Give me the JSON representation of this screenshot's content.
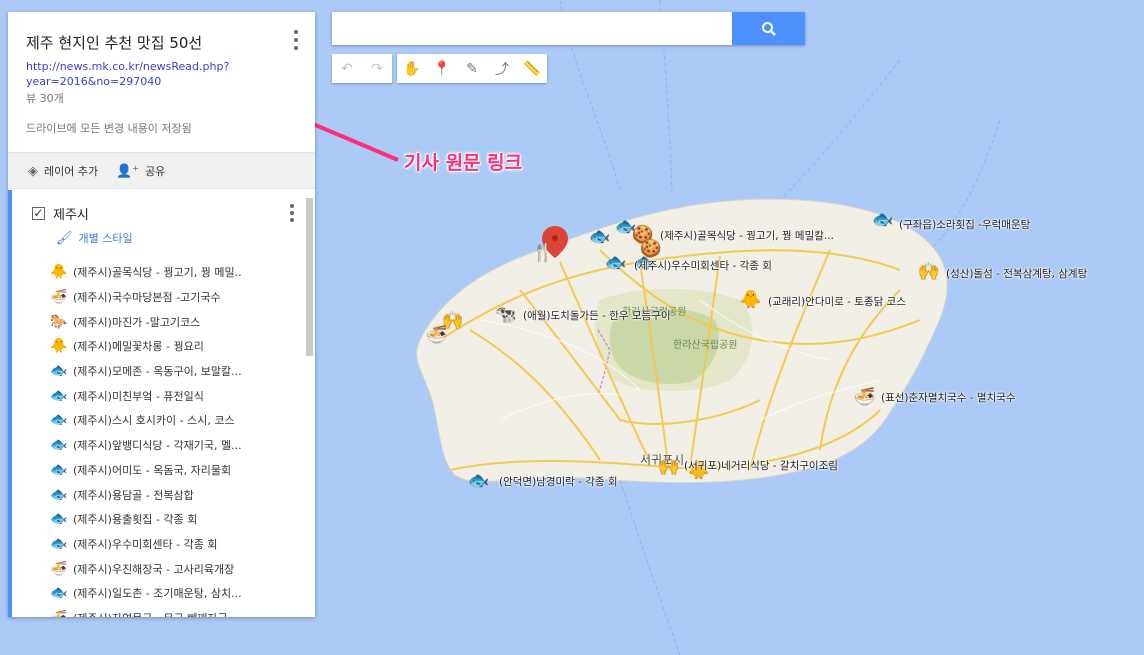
{
  "panel": {
    "title": "제주 현지인 추천 맛집 50선",
    "link_line1": "http://news.mk.co.kr/newsRead.php?",
    "link_line2": "year=2016&no=297040",
    "views": "뷰 30개",
    "saved_status": "드라이브에 모든 변경 내용이 저장됨",
    "add_layer": "레이어 추가",
    "share": "공유",
    "layer_name": "제주시",
    "layer_style": "개별 스타일",
    "items": [
      {
        "label": "(제주시)골목식당 - 꿩고기, 꿩 메밀..",
        "icon": "chicken-icon"
      },
      {
        "label": "(제주시)국수마당본점 -고기국수",
        "icon": "noodle-icon"
      },
      {
        "label": "(제주시)마진가 -말고기코스",
        "icon": "horse-icon"
      },
      {
        "label": "(제주시)메밀꽃차롱 - 꿩요리",
        "icon": "chicken-icon"
      },
      {
        "label": "(제주시)모메존 - 옥동구이, 보말칼...",
        "icon": "fish-icon"
      },
      {
        "label": "(제주시)미친부엌 - 퓨전일식",
        "icon": "fish-icon"
      },
      {
        "label": "(제주시)스시 호시카이  - 스시, 코스",
        "icon": "fish-icon"
      },
      {
        "label": "(제주시)앞뱅디식당 - 각재기국, 멜...",
        "icon": "fish-icon"
      },
      {
        "label": "(제주시)어미도 - 옥돔국, 자리물회",
        "icon": "fish-icon"
      },
      {
        "label": "(제주시)용담골 - 전복삼합",
        "icon": "fish-icon"
      },
      {
        "label": "(제주시)용출횟집 - 각종 회",
        "icon": "fish-icon"
      },
      {
        "label": "(제주시)우수미회센타 - 각종 회",
        "icon": "fish-icon"
      },
      {
        "label": "(제주시)우진해장국 - 고사리육개장",
        "icon": "noodle-icon"
      },
      {
        "label": "(제주시)일도촌 - 조기매운탕, 삼치...",
        "icon": "fish-icon"
      },
      {
        "label": "(제주시)자연문구 - 무구 빼깨자국...",
        "icon": "noodle-icon"
      }
    ]
  },
  "search": {
    "value": "",
    "placeholder": ""
  },
  "annotation": "기사 원문 링크",
  "map": {
    "area_labels": [
      "한라산국립공원",
      "한라산국립공원"
    ],
    "city_label": "서귀포시",
    "pins": [
      {
        "label": "(제주시)골목식당 - 꿩고기, 꿩 메밀칼...",
        "icon": "fish-icon"
      },
      {
        "label": "(제주시)우수미회센타 - 각종 회",
        "icon": "fish-icon"
      },
      {
        "label": "(구좌읍)소라횟집 -우럭매운탕",
        "icon": "fish-icon"
      },
      {
        "label": "(성산)돌섬 - 전복삼계탕, 삼계탕",
        "icon": "hands-icon"
      },
      {
        "label": "(교래리)안다미로 - 토종닭 코스",
        "icon": "chicken-icon"
      },
      {
        "label": "(애월)도치돌가든 - 한우 모듬구이",
        "icon": "cow-icon"
      },
      {
        "label": "(표선)춘자멸치국수 - 멸치국수",
        "icon": "noodle-icon"
      },
      {
        "label": "(서귀포)네거리식당 - 갈치구이조림",
        "icon": "fish-icon"
      },
      {
        "label": "(안덕면)남경미락 - 각종 회",
        "icon": "fish-icon"
      }
    ]
  },
  "colors": {
    "water": "#abcaf7",
    "land": "#f2efe6",
    "accent": "#4d90fe",
    "annotation": "#ff2d7a"
  }
}
